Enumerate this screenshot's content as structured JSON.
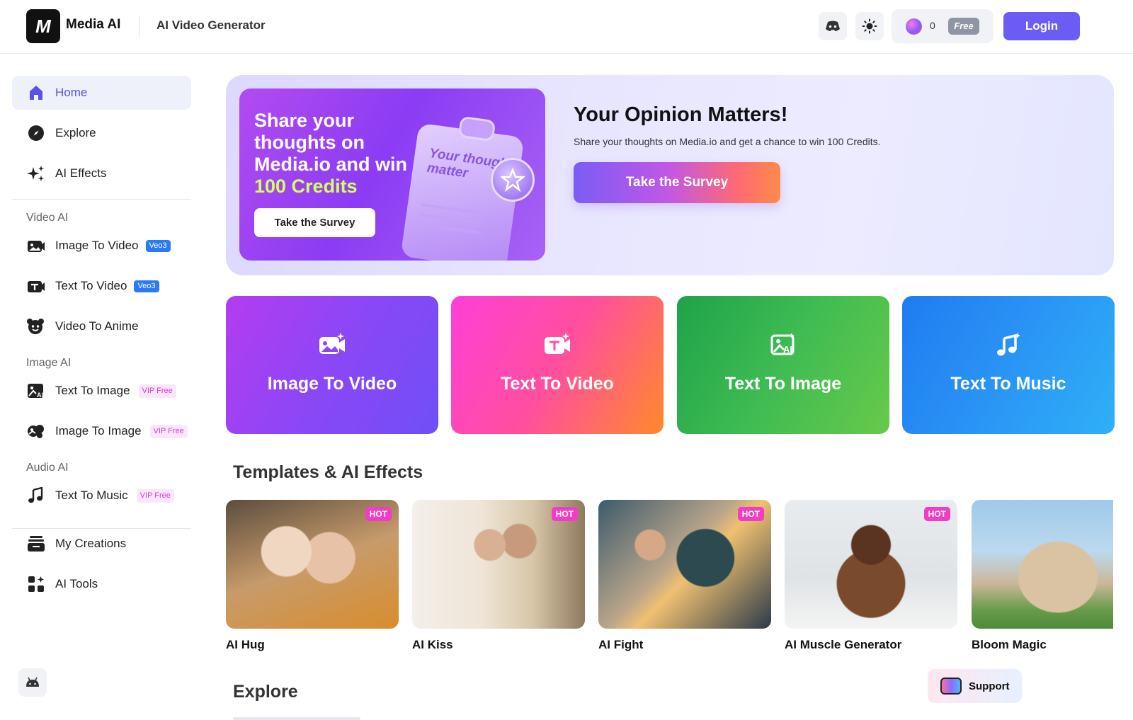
{
  "header": {
    "brand": "Media AI",
    "logo_text": "M",
    "page_title": "AI Video Generator",
    "credits": "0",
    "plan_badge": "Free",
    "login_label": "Login"
  },
  "sidebar": {
    "home": "Home",
    "explore": "Explore",
    "ai_effects": "AI Effects",
    "video_section": "Video AI",
    "image_to_video": "Image To Video",
    "image_to_video_tag": "Veo3",
    "text_to_video": "Text To Video",
    "text_to_video_tag": "Veo3",
    "video_to_anime": "Video To Anime",
    "image_section": "Image AI",
    "text_to_image": "Text To Image",
    "text_to_image_tag": "VIP Free",
    "image_to_image": "Image To Image",
    "image_to_image_tag": "VIP Free",
    "audio_section": "Audio AI",
    "text_to_music": "Text To Music",
    "text_to_music_tag": "VIP Free",
    "my_creations": "My Creations",
    "ai_tools": "AI Tools"
  },
  "banner": {
    "promo_line1": "Share your thoughts on Media.io and win",
    "promo_highlight": "100 Credits",
    "promo_button": "Take the Survey",
    "clipboard_text": "Your thoughts matter",
    "title": "Your Opinion Matters!",
    "subtitle": "Share your thoughts on Media.io and get a chance to win 100 Credits.",
    "button": "Take the Survey"
  },
  "features": [
    {
      "label": "Image To Video"
    },
    {
      "label": "Text To Video"
    },
    {
      "label": "Text To Image"
    },
    {
      "label": "Text To Music"
    }
  ],
  "templates_title": "Templates & AI Effects",
  "templates": [
    {
      "name": "AI Hug",
      "badge": "HOT"
    },
    {
      "name": "AI Kiss",
      "badge": "HOT"
    },
    {
      "name": "AI Fight",
      "badge": "HOT"
    },
    {
      "name": "AI Muscle Generator",
      "badge": "HOT"
    },
    {
      "name": "Bloom Magic"
    }
  ],
  "explore_title": "Explore",
  "support_label": "Support",
  "colors": {
    "accent": "#6b5cf6",
    "veo_tag": "#2a7bf3",
    "vip_tag": "#d33ad6",
    "hot_badge": "#f23cc3"
  }
}
